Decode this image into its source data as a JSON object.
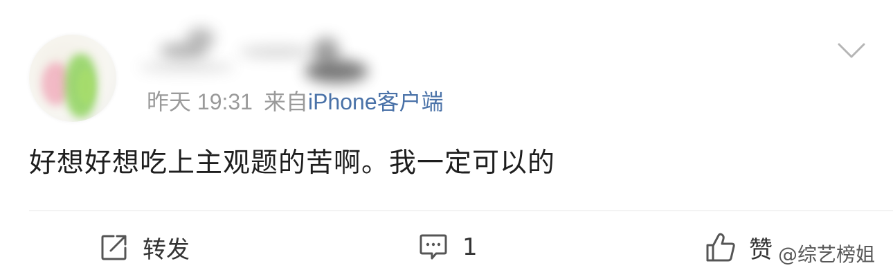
{
  "post": {
    "meta": {
      "time": "昨天 19:31",
      "source_prefix": "来自",
      "source": "iPhone客户端"
    },
    "content": "好想好想吃上主观题的苦啊。我一定可以的",
    "icons": {
      "dropdown": "chevron-down-icon",
      "repost": "share-icon",
      "comment": "comment-icon",
      "like": "thumbs-up-icon"
    }
  },
  "actions": {
    "repost_label": "转发",
    "comment_count": "1",
    "like_label": "赞"
  },
  "watermark": "@综艺榜姐",
  "colors": {
    "source_link": "#4a72a8",
    "meta_text": "#9a9a9a",
    "body_text": "#1e1e1e",
    "divider": "#e6e6e6"
  }
}
